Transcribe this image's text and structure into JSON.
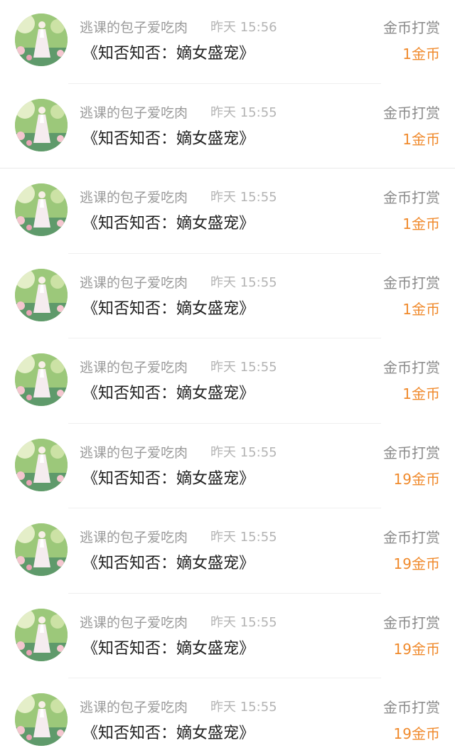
{
  "records": [
    {
      "username": "逃课的包子爱吃肉",
      "time": "昨天 15:56",
      "title": "《知否知否：嫡女盛宠》",
      "type": "金币打赏",
      "amount": "1金币"
    },
    {
      "username": "逃课的包子爱吃肉",
      "time": "昨天 15:55",
      "title": "《知否知否：嫡女盛宠》",
      "type": "金币打赏",
      "amount": "1金币"
    },
    {
      "username": "逃课的包子爱吃肉",
      "time": "昨天 15:55",
      "title": "《知否知否：嫡女盛宠》",
      "type": "金币打赏",
      "amount": "1金币"
    },
    {
      "username": "逃课的包子爱吃肉",
      "time": "昨天 15:55",
      "title": "《知否知否：嫡女盛宠》",
      "type": "金币打赏",
      "amount": "1金币"
    },
    {
      "username": "逃课的包子爱吃肉",
      "time": "昨天 15:55",
      "title": "《知否知否：嫡女盛宠》",
      "type": "金币打赏",
      "amount": "1金币"
    },
    {
      "username": "逃课的包子爱吃肉",
      "time": "昨天 15:55",
      "title": "《知否知否：嫡女盛宠》",
      "type": "金币打赏",
      "amount": "19金币"
    },
    {
      "username": "逃课的包子爱吃肉",
      "time": "昨天 15:55",
      "title": "《知否知否：嫡女盛宠》",
      "type": "金币打赏",
      "amount": "19金币"
    },
    {
      "username": "逃课的包子爱吃肉",
      "time": "昨天 15:55",
      "title": "《知否知否：嫡女盛宠》",
      "type": "金币打赏",
      "amount": "19金币"
    },
    {
      "username": "逃课的包子爱吃肉",
      "time": "昨天 15:55",
      "title": "《知否知否：嫡女盛宠》",
      "type": "金币打赏",
      "amount": "19金币"
    }
  ],
  "colors": {
    "amount": "#f08a2c",
    "username": "#9a9a9a",
    "time": "#b4b4b4",
    "title": "#1f1f1f",
    "type": "#8a8a8a"
  },
  "icons": {
    "avatar": "avatar-girl-in-garden"
  }
}
